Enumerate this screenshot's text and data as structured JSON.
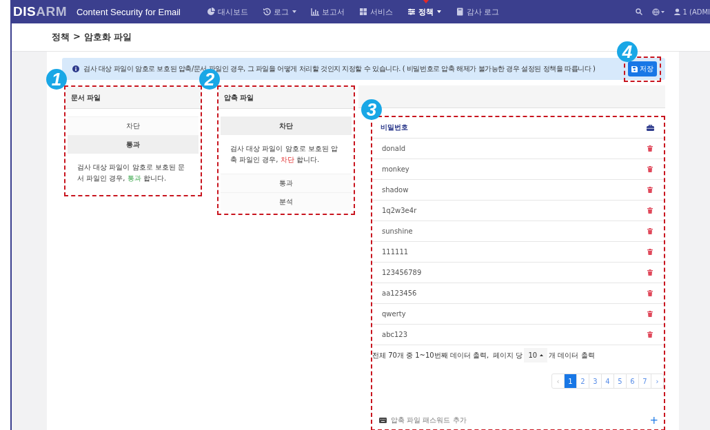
{
  "navbar": {
    "logo_primary": "DIS",
    "logo_secondary": "ARM",
    "product": "Content Security for Email",
    "menu": [
      {
        "label": "대시보드",
        "dropdown": false,
        "selected": false
      },
      {
        "label": "로그",
        "dropdown": true,
        "selected": false
      },
      {
        "label": "보고서",
        "dropdown": false,
        "selected": false
      },
      {
        "label": "서비스",
        "dropdown": false,
        "selected": false
      },
      {
        "label": "정책",
        "dropdown": true,
        "selected": true
      },
      {
        "label": "감사 로그",
        "dropdown": false,
        "selected": false
      }
    ],
    "user": "1 (ADMI"
  },
  "breadcrumb": {
    "parent": "정책",
    "separator": ">",
    "current": "암호화 파일"
  },
  "notice": "검사 대상 파일이 암호로 보호된 압축/문서 파일인 경우, 그 파일을 어떻게 처리할 것인지 지정할 수 있습니다. ( 비밀번호로 압축 해제가 불가능한 경우 설정된 정책을 따릅니다 )",
  "save_button": "저장",
  "policy_cards": [
    {
      "title": "문서 파일",
      "options": [
        {
          "label": "차단",
          "selected": false
        },
        {
          "label": "통과",
          "selected": true
        }
      ],
      "description": {
        "before": "검사 대상 파일이 암호로 보호된 문서 파일인 경우, ",
        "action": "통과",
        "after": " 합니다.",
        "kind": "pass"
      }
    },
    {
      "title": "압축 파일",
      "options": [
        {
          "label": "차단",
          "selected": true
        },
        {
          "label": "통과",
          "selected": false
        },
        {
          "label": "분석",
          "selected": false
        }
      ],
      "description": {
        "before": "검사 대상 파일이 암호로 보호된 압축 파일인 경우, ",
        "action": "차단",
        "after": " 합니다.",
        "kind": "block"
      }
    }
  ],
  "password_list": {
    "title": "비밀번호",
    "rows": [
      "donald",
      "monkey",
      "shadow",
      "1q2w3e4r",
      "sunshine",
      "111111",
      "123456789",
      "aa123456",
      "qwerty",
      "abc123"
    ],
    "summary": "전체 70개 중 1~10번째 데이터 출력,",
    "per_page_label": "페이지 당",
    "per_page": "10",
    "per_page_suffix": "개 데이터 출력",
    "pagination": {
      "prev": "‹",
      "next": "›",
      "pages": [
        {
          "label": "1",
          "selected": true
        },
        {
          "label": "2",
          "selected": false
        },
        {
          "label": "3",
          "selected": false
        },
        {
          "label": "4",
          "selected": false
        },
        {
          "label": "5",
          "selected": false
        },
        {
          "label": "6",
          "selected": false
        },
        {
          "label": "7",
          "selected": false
        }
      ]
    },
    "add_label": "압축 파일 패스워드 추가",
    "add_button": "+"
  },
  "callouts": [
    "1",
    "2",
    "3",
    "4"
  ]
}
